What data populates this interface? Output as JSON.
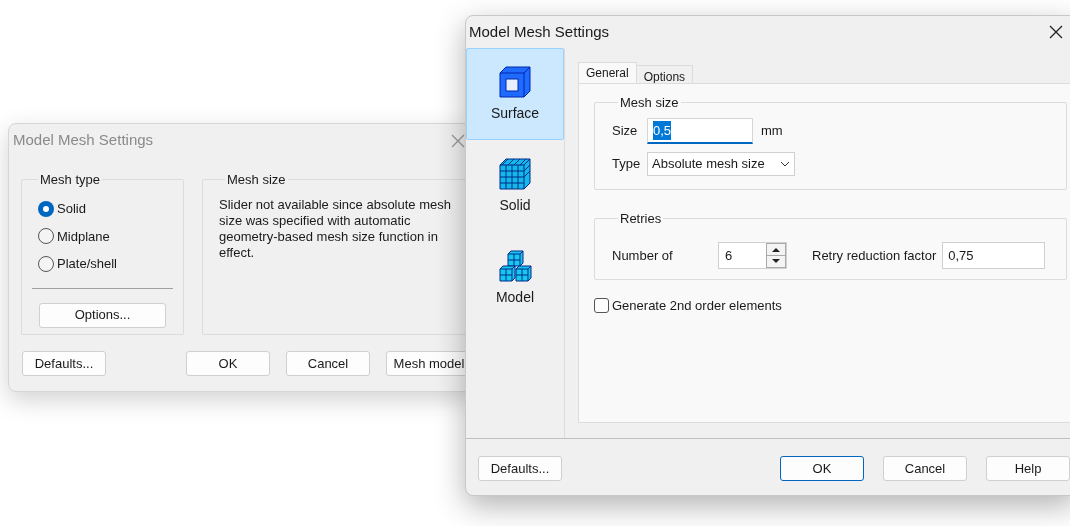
{
  "back_window": {
    "title": "Model Mesh Settings",
    "active": false,
    "mesh_type": {
      "label": "Mesh type",
      "options": [
        {
          "label": "Solid",
          "selected": true
        },
        {
          "label": "Midplane",
          "selected": false
        },
        {
          "label": "Plate/shell",
          "selected": false
        }
      ],
      "options_button": "Options..."
    },
    "mesh_size": {
      "label": "Mesh size",
      "message": "Slider not available since absolute mesh size was specified with automatic geometry-based mesh size function in effect."
    },
    "buttons": [
      "Defaults...",
      "OK",
      "Cancel",
      "Mesh model"
    ]
  },
  "front_window": {
    "title": "Model Mesh Settings",
    "active": true,
    "sidebar": [
      {
        "label": "Surface",
        "kind": "surface",
        "selected": true
      },
      {
        "label": "Solid",
        "kind": "solid",
        "selected": false
      },
      {
        "label": "Model",
        "kind": "model",
        "selected": false
      }
    ],
    "tabs": [
      {
        "label": "General",
        "selected": true
      },
      {
        "label": "Options",
        "selected": false
      }
    ],
    "mesh_size": {
      "label": "Mesh size",
      "size_label": "Size",
      "size_value": "0,5",
      "size_highlighted": true,
      "unit": "mm",
      "type_label": "Type",
      "type_value": "Absolute mesh size"
    },
    "retries": {
      "label": "Retries",
      "number_label": "Number of",
      "number_value": "6",
      "factor_label": "Retry reduction factor",
      "factor_value": "0,75"
    },
    "second_order": {
      "label": "Generate 2nd order elements",
      "checked": false
    },
    "buttons": [
      {
        "label": "Defaults...",
        "default": false
      },
      {
        "label": "OK",
        "default": true
      },
      {
        "label": "Cancel",
        "default": false
      },
      {
        "label": "Help",
        "default": false
      }
    ]
  }
}
